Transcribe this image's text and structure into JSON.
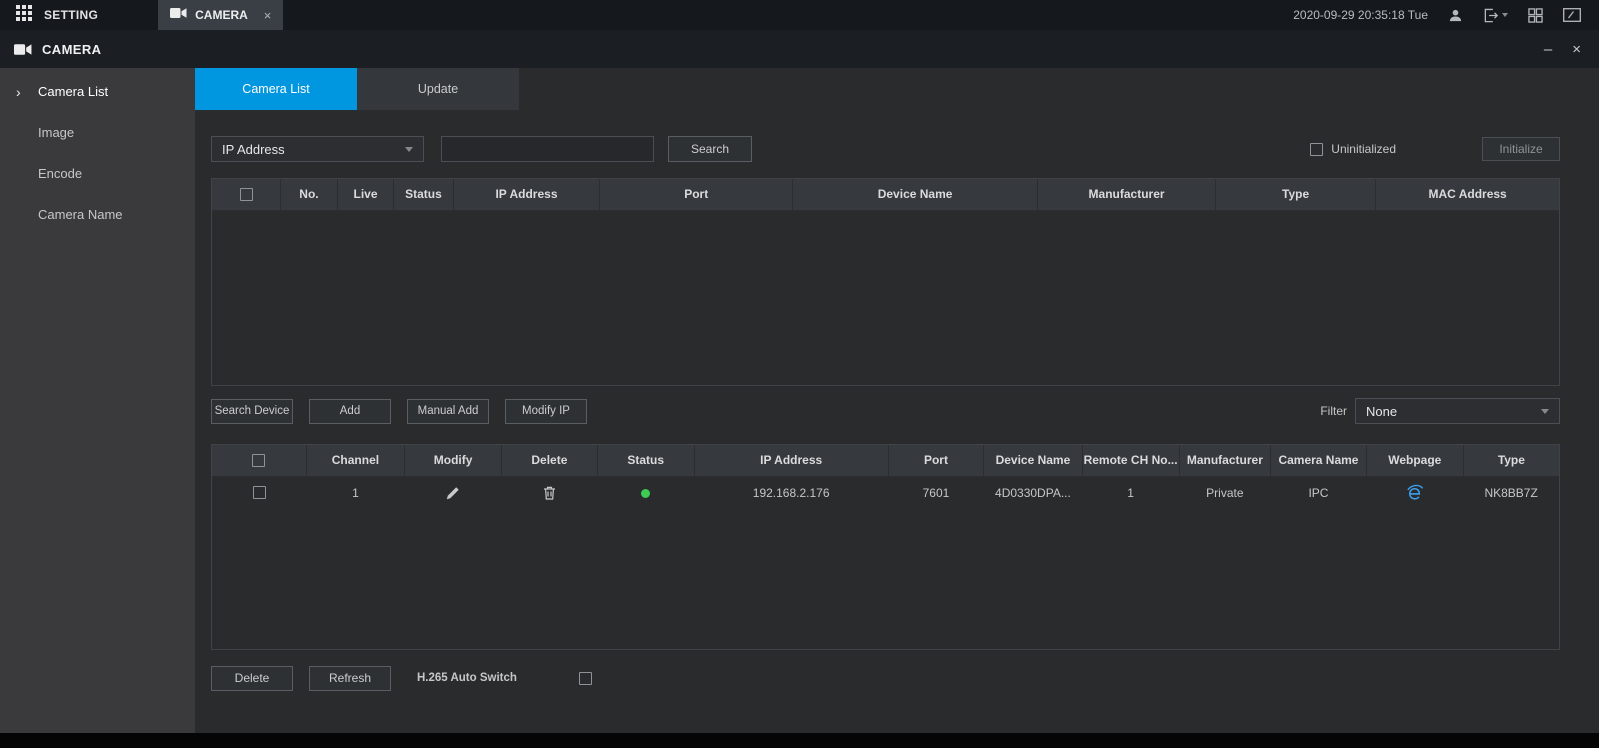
{
  "icons": {
    "minimize": "–",
    "close": "×",
    "tab_close": "×",
    "sidebar_arrow": "›"
  },
  "topbar": {
    "setting_label": "SETTING",
    "camera_tab_label": "CAMERA",
    "datetime": "2020-09-29 20:35:18 Tue"
  },
  "window": {
    "title": "CAMERA"
  },
  "sidebar": {
    "items": [
      {
        "label": "Camera List",
        "active": true
      },
      {
        "label": "Image",
        "active": false
      },
      {
        "label": "Encode",
        "active": false
      },
      {
        "label": "Camera Name",
        "active": false
      }
    ]
  },
  "tabs": {
    "camera_list": "Camera List",
    "update": "Update"
  },
  "search": {
    "type_value": "IP Address",
    "input_value": "",
    "search_button": "Search",
    "uninitialized_label": "Uninitialized",
    "initialize_button": "Initialize"
  },
  "device_table": {
    "headers": [
      "No.",
      "Live",
      "Status",
      "IP Address",
      "Port",
      "Device Name",
      "Manufacturer",
      "Type",
      "MAC Address"
    ],
    "rows": []
  },
  "actions": {
    "search_device": "Search Device",
    "add": "Add",
    "manual_add": "Manual Add",
    "modify_ip": "Modify IP",
    "filter_label": "Filter",
    "filter_value": "None"
  },
  "added_table": {
    "headers": [
      "Channel",
      "Modify",
      "Delete",
      "Status",
      "IP Address",
      "Port",
      "Device Name",
      "Remote CH No...",
      "Manufacturer",
      "Camera Name",
      "Webpage",
      "Type"
    ],
    "rows": [
      {
        "channel": "1",
        "ip_address": "192.168.2.176",
        "port": "7601",
        "device_name": "4D0330DPA...",
        "remote_ch_no": "1",
        "manufacturer": "Private",
        "camera_name": "IPC",
        "type": "NK8BB7Z"
      }
    ]
  },
  "footer": {
    "delete_button": "Delete",
    "refresh_button": "Refresh",
    "h265_label": "H.265 Auto Switch"
  },
  "colors": {
    "accent": "#0096e0",
    "status_online": "#3ecb53",
    "ie_blue": "#3aa0f0"
  }
}
